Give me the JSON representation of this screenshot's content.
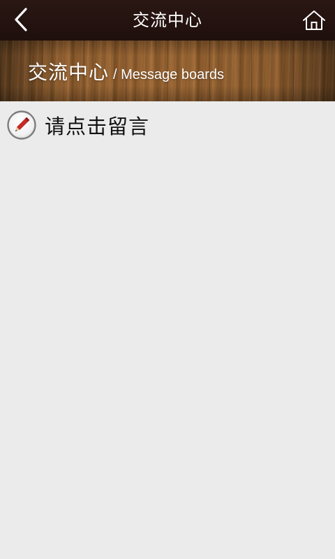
{
  "topbar": {
    "title": "交流中心",
    "back_icon": "chevron-left-icon",
    "home_icon": "home-icon"
  },
  "banner": {
    "title": "交流中心",
    "subtitle": "/ Message boards"
  },
  "content": {
    "leave_message_label": "请点击留言",
    "leave_message_icon": "pencil-icon"
  },
  "colors": {
    "topbar_bg": "#24130f",
    "content_bg": "#ebebeb",
    "pencil_red": "#c62828"
  }
}
